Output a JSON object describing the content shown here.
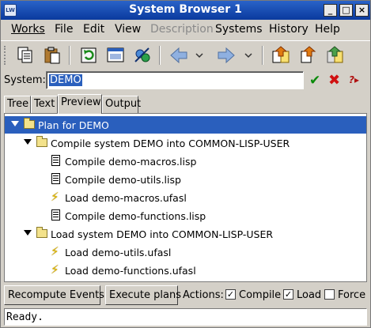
{
  "window": {
    "title": "System Browser 1",
    "app_icon": "LW"
  },
  "menubar": {
    "items": [
      {
        "label": "Works",
        "disabled": false
      },
      {
        "label": "File",
        "disabled": false
      },
      {
        "label": "Edit",
        "disabled": false
      },
      {
        "label": "View",
        "disabled": false
      },
      {
        "label": "Description",
        "disabled": true
      },
      {
        "label": "Systems",
        "disabled": false
      },
      {
        "label": "History",
        "disabled": false
      },
      {
        "label": "Help",
        "disabled": false
      }
    ]
  },
  "toolbar": {
    "icons": [
      "copy-icon",
      "paste-icon",
      "refresh-icon",
      "window-icon",
      "inspect-icon",
      "back-icon",
      "back-dropdown-icon",
      "forward-icon",
      "forward-dropdown-icon",
      "compile-load-icon",
      "compile-icon",
      "load-icon"
    ]
  },
  "system": {
    "label": "System:",
    "value": "DEMO"
  },
  "tabs": [
    "Tree",
    "Text",
    "Preview",
    "Output"
  ],
  "active_tab": "Preview",
  "plan": {
    "rows": [
      {
        "level": 0,
        "type": "folder",
        "label": "Plan for DEMO",
        "selected": true
      },
      {
        "level": 1,
        "type": "folder",
        "label": "Compile system DEMO into COMMON-LISP-USER"
      },
      {
        "level": 2,
        "type": "compile",
        "label": "Compile demo-macros.lisp"
      },
      {
        "level": 2,
        "type": "compile",
        "label": "Compile demo-utils.lisp"
      },
      {
        "level": 2,
        "type": "load",
        "label": "Load demo-macros.ufasl"
      },
      {
        "level": 2,
        "type": "compile",
        "label": "Compile demo-functions.lisp"
      },
      {
        "level": 1,
        "type": "folder",
        "label": "Load system DEMO into COMMON-LISP-USER"
      },
      {
        "level": 2,
        "type": "load",
        "label": "Load demo-utils.ufasl"
      },
      {
        "level": 2,
        "type": "load",
        "label": "Load demo-functions.ufasl"
      }
    ]
  },
  "bottombar": {
    "recompute_label": "Recompute Events",
    "execute_label": "Execute plans",
    "actions_label": "Actions:",
    "checks": [
      {
        "label": "Compile",
        "checked": true
      },
      {
        "label": "Load",
        "checked": true
      },
      {
        "label": "Force",
        "checked": false
      }
    ]
  },
  "status": {
    "text": "Ready."
  }
}
